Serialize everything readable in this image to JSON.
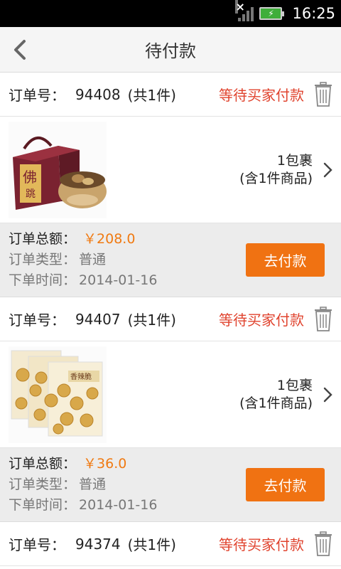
{
  "status_bar": {
    "time": "16:25",
    "signal_mark": "×"
  },
  "header": {
    "title": "待付款"
  },
  "labels": {
    "order_no": "订单号：",
    "total": "订单总额：",
    "type": "订单类型：",
    "time": "下单时间：",
    "pay": "去付款",
    "status": "等待买家付款"
  },
  "orders": [
    {
      "order_no": "94408",
      "count": "(共1件)",
      "package": "1包裹",
      "items": "(含1件商品)",
      "total": "￥208.0",
      "type": "普通",
      "date": "2014-01-16"
    },
    {
      "order_no": "94407",
      "count": "(共1件)",
      "package": "1包裹",
      "items": "(含1件商品)",
      "total": "￥36.0",
      "type": "普通",
      "date": "2014-01-16"
    },
    {
      "order_no": "94374",
      "count": "(共1件)"
    }
  ],
  "colors": {
    "accent": "#f07212",
    "status": "#e0432e",
    "price": "#f07a12"
  }
}
